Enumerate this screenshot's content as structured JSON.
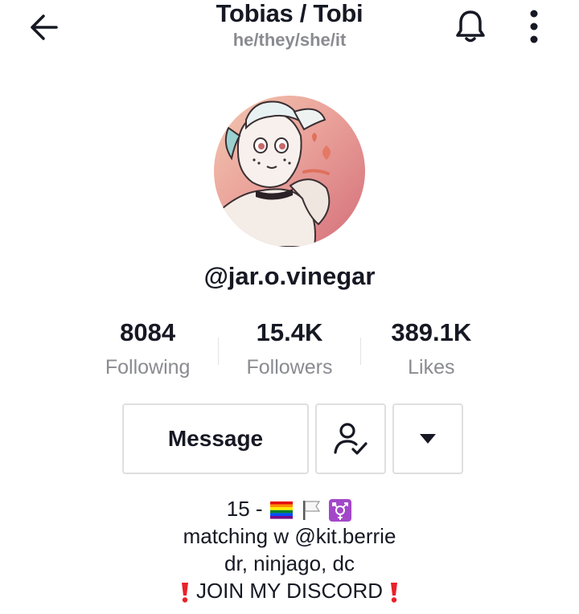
{
  "header": {
    "display_name": "Tobias / Tobi",
    "pronouns": "he/they/she/it",
    "back_icon": "arrow-left-icon",
    "notification_icon": "bell-icon",
    "more_icon": "vertical-dots-icon"
  },
  "profile": {
    "username": "@jar.o.vinegar"
  },
  "stats": [
    {
      "value": "8084",
      "label": "Following"
    },
    {
      "value": "15.4K",
      "label": "Followers"
    },
    {
      "value": "389.1K",
      "label": "Likes"
    }
  ],
  "actions": {
    "message_label": "Message",
    "friend_icon": "user-check-icon",
    "dropdown_icon": "caret-down-icon"
  },
  "bio": {
    "line1_prefix": "15 - ",
    "line1_flags": [
      "rainbow-flag",
      "white-flag",
      "transgender-symbol"
    ],
    "line2": "matching w @kit.berrie",
    "line3": "dr, ninjago, dc",
    "line4": "JOIN MY DISCORD",
    "line4_icon": "exclamation-icon"
  },
  "colors": {
    "text_primary": "#161823",
    "text_secondary": "#8a8b91",
    "border": "#dfdfe1",
    "accent_red": "#e8222a"
  }
}
